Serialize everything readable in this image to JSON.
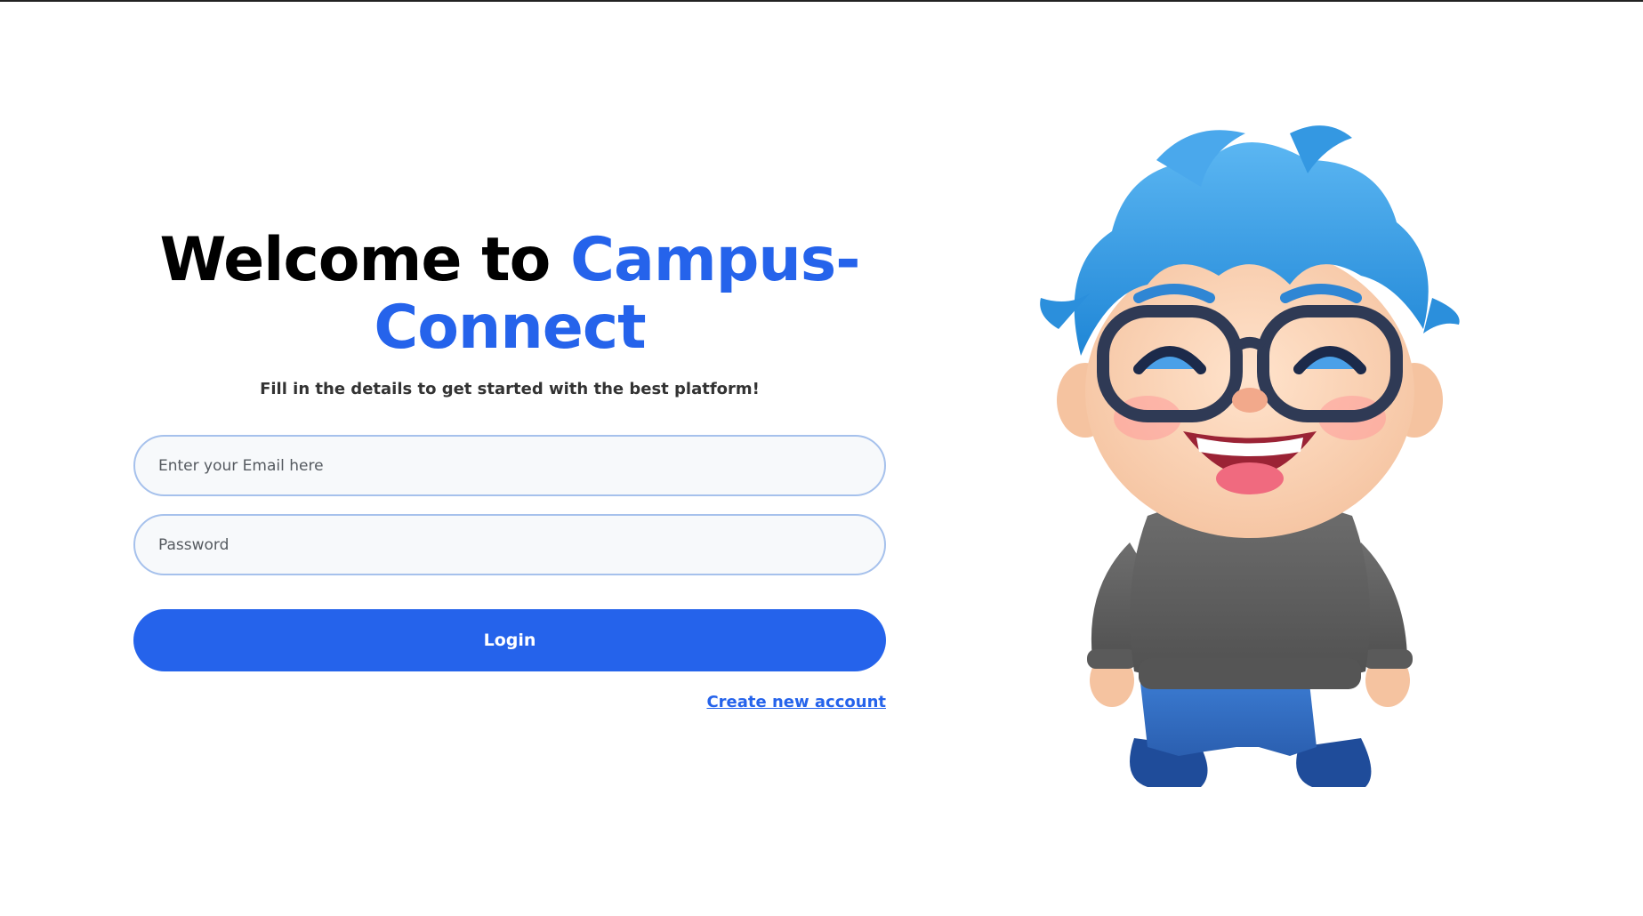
{
  "header": {
    "title_prefix": "Welcome to ",
    "title_brand": "Campus-Connect",
    "subtitle": "Fill in the details to get started with the best platform!"
  },
  "form": {
    "email_placeholder": "Enter your Email here",
    "password_placeholder": "Password",
    "login_label": "Login",
    "create_account_label": "Create new account"
  },
  "colors": {
    "accent": "#2563eb",
    "title_text": "#000000",
    "input_border": "#a6c1ec",
    "input_background": "#f7f9fb"
  },
  "illustration": {
    "icon": "cartoon-boy-mascot"
  }
}
